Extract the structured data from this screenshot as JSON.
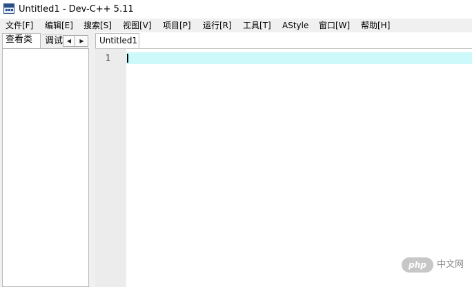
{
  "window": {
    "title": "Untitled1 - Dev-C++ 5.11",
    "icon": "dev-cpp-app-icon"
  },
  "menubar": {
    "items": [
      {
        "label": "文件[F]"
      },
      {
        "label": "编辑[E]"
      },
      {
        "label": "搜索[S]"
      },
      {
        "label": "视图[V]"
      },
      {
        "label": "项目[P]"
      },
      {
        "label": "运行[R]"
      },
      {
        "label": "工具[T]"
      },
      {
        "label": "AStyle"
      },
      {
        "label": "窗口[W]"
      },
      {
        "label": "帮助[H]"
      }
    ]
  },
  "left_panel": {
    "tabs": [
      {
        "label": "查看类",
        "active": true
      },
      {
        "label": "调试",
        "active": false
      }
    ],
    "scroll_left_icon": "triangle-left-icon",
    "scroll_right_icon": "triangle-right-icon"
  },
  "editor": {
    "tab_label": "Untitled1",
    "line_numbers": [
      "1"
    ],
    "lines": [
      ""
    ],
    "current_line_color": "#cdf9fb"
  },
  "watermark": {
    "logo_text": "php",
    "text": "中文网"
  }
}
